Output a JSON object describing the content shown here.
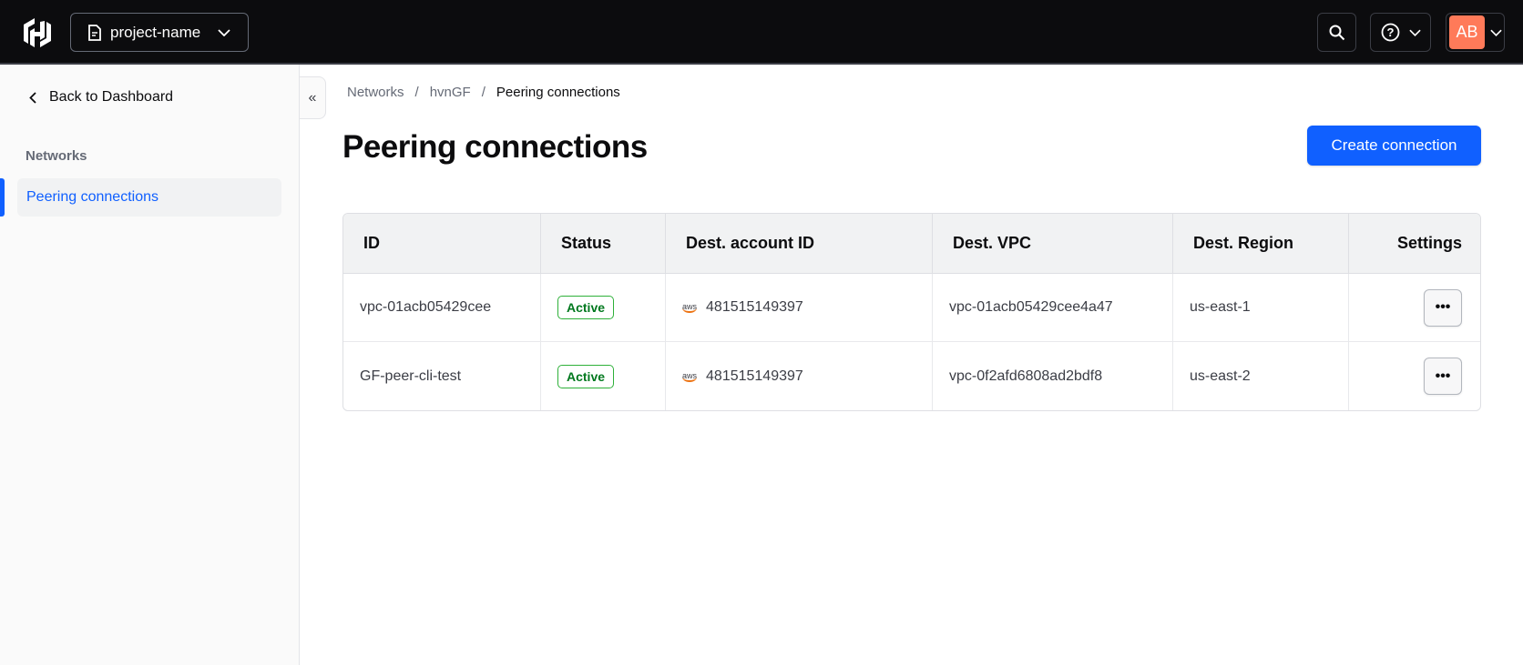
{
  "header": {
    "project_name": "project-name",
    "avatar_initials": "AB",
    "logo": "hashicorp-logo",
    "colors": {
      "background": "#0c0c0e",
      "avatar": "#ff7a59"
    }
  },
  "sidebar": {
    "back_label": "Back to Dashboard",
    "section_title": "Networks",
    "items": [
      {
        "label": "Peering connections",
        "active": true
      }
    ]
  },
  "breadcrumb": [
    "Networks",
    "hvnGF",
    "Peering connections"
  ],
  "page": {
    "title": "Peering connections",
    "create_button": "Create connection",
    "accent": "#1060ff"
  },
  "table": {
    "columns": [
      "ID",
      "Status",
      "Dest. account ID",
      "Dest. VPC",
      "Dest. Region",
      "Settings"
    ],
    "rows": [
      {
        "id": "vpc-01acb05429cee",
        "status": "Active",
        "provider": "aws",
        "account": "481515149397",
        "vpc": "vpc-01acb05429cee4a47",
        "region": "us-east-1",
        "settings": "•••"
      },
      {
        "id": "GF-peer-cli-test",
        "status": "Active",
        "provider": "aws",
        "account": "481515149397",
        "vpc": "vpc-0f2afd6808ad2bdf8",
        "region": "us-east-2",
        "settings": "•••"
      }
    ]
  }
}
